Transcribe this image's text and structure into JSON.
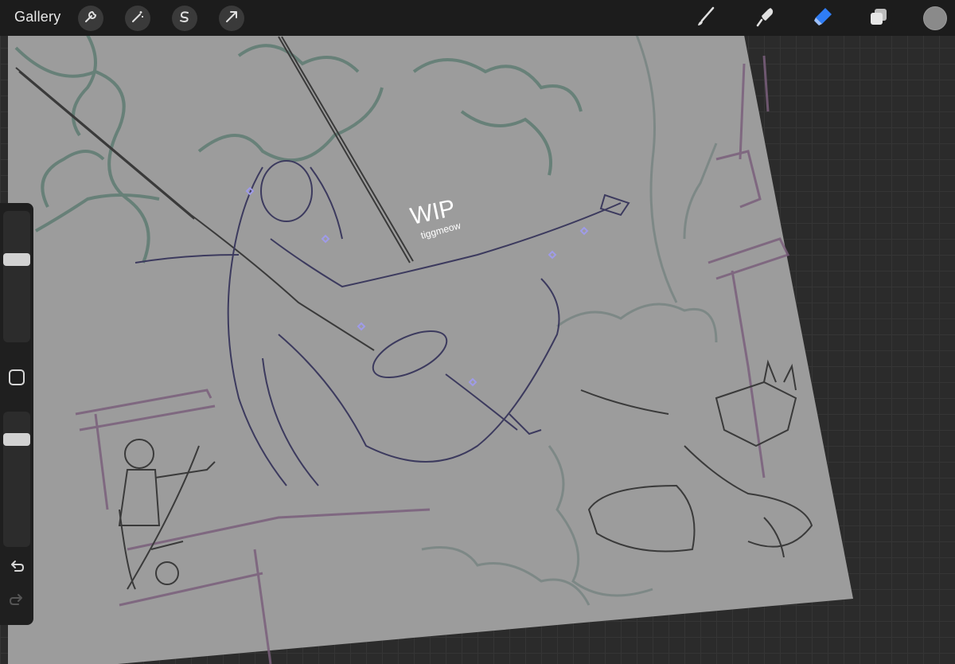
{
  "toolbar": {
    "gallery_label": "Gallery",
    "left_tools": [
      {
        "name": "actions",
        "icon": "wrench-icon"
      },
      {
        "name": "adjustments",
        "icon": "magic-wand-icon"
      },
      {
        "name": "selection",
        "icon": "selection-s-icon"
      },
      {
        "name": "transform",
        "icon": "arrow-cursor-icon"
      }
    ],
    "right_tools": [
      {
        "name": "brush",
        "icon": "brush-icon",
        "active": false
      },
      {
        "name": "smudge",
        "icon": "smudge-icon",
        "active": false
      },
      {
        "name": "eraser",
        "icon": "eraser-icon",
        "active": true
      },
      {
        "name": "layers",
        "icon": "layers-icon",
        "active": false
      }
    ],
    "current_color": "#8a8a8a",
    "accent_color": "#2f7df6"
  },
  "sidebar": {
    "brush_size_level": 0.5,
    "opacity_level": 0.5,
    "modify_button": "square-icon",
    "undo": "undo-icon",
    "redo": "redo-icon"
  },
  "canvas": {
    "watermark_title": "WIP",
    "watermark_signature": "tiggmeow",
    "background_color": "#9a9a9a"
  }
}
